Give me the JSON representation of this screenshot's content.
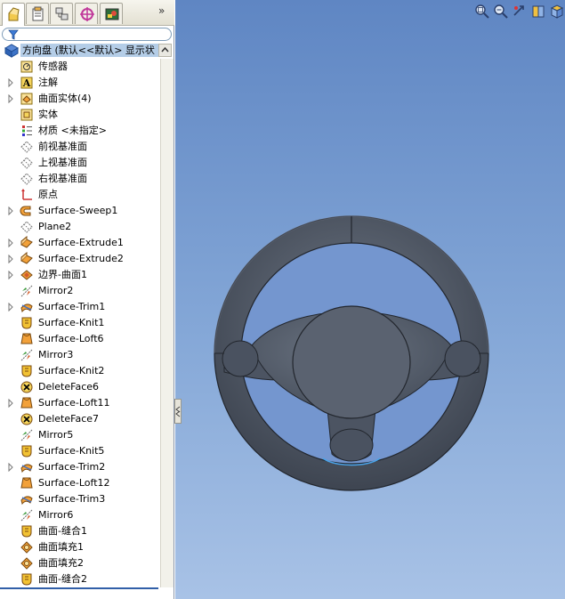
{
  "panel": {
    "tabs": [
      {
        "name": "featuremanager-tab",
        "icon": "feature-tree-icon"
      },
      {
        "name": "propertymanager-tab",
        "icon": "property-manager-icon"
      },
      {
        "name": "configurationmanager-tab",
        "icon": "configuration-manager-icon"
      },
      {
        "name": "dimxpert-tab",
        "icon": "dimxpert-icon"
      },
      {
        "name": "display-manager-tab",
        "icon": "display-manager-icon"
      }
    ],
    "more_tabs_glyph": "»"
  },
  "tree": {
    "root_label": "方向盘 (默认<<默认> 显示状",
    "items": [
      {
        "label": "传感器",
        "icon": "sensor-icon",
        "expandable": false
      },
      {
        "label": "注解",
        "icon": "annotation-icon",
        "expandable": true
      },
      {
        "label": "曲面实体(4)",
        "icon": "surface-bodies-icon",
        "expandable": true
      },
      {
        "label": "实体",
        "icon": "solid-bodies-icon",
        "expandable": false
      },
      {
        "label": "材质 <未指定>",
        "icon": "material-icon",
        "expandable": false
      },
      {
        "label": "前视基准面",
        "icon": "plane-icon",
        "expandable": false
      },
      {
        "label": "上视基准面",
        "icon": "plane-icon",
        "expandable": false
      },
      {
        "label": "右视基准面",
        "icon": "plane-icon",
        "expandable": false
      },
      {
        "label": "原点",
        "icon": "origin-icon",
        "expandable": false
      },
      {
        "label": "Surface-Sweep1",
        "icon": "surface-sweep-icon",
        "expandable": true
      },
      {
        "label": "Plane2",
        "icon": "plane-icon",
        "expandable": false
      },
      {
        "label": "Surface-Extrude1",
        "icon": "surface-extrude-icon",
        "expandable": true
      },
      {
        "label": "Surface-Extrude2",
        "icon": "surface-extrude-icon",
        "expandable": true
      },
      {
        "label": "边界-曲面1",
        "icon": "boundary-surface-icon",
        "expandable": true
      },
      {
        "label": "Mirror2",
        "icon": "mirror-icon",
        "expandable": false
      },
      {
        "label": "Surface-Trim1",
        "icon": "surface-trim-icon",
        "expandable": true
      },
      {
        "label": "Surface-Knit1",
        "icon": "surface-knit-icon",
        "expandable": false
      },
      {
        "label": "Surface-Loft6",
        "icon": "surface-loft-icon",
        "expandable": false
      },
      {
        "label": "Mirror3",
        "icon": "mirror-icon",
        "expandable": false
      },
      {
        "label": "Surface-Knit2",
        "icon": "surface-knit-icon",
        "expandable": false
      },
      {
        "label": "DeleteFace6",
        "icon": "delete-face-icon",
        "expandable": false
      },
      {
        "label": "Surface-Loft11",
        "icon": "surface-loft-icon",
        "expandable": true
      },
      {
        "label": "DeleteFace7",
        "icon": "delete-face-icon",
        "expandable": false
      },
      {
        "label": "Mirror5",
        "icon": "mirror-icon",
        "expandable": false
      },
      {
        "label": "Surface-Knit5",
        "icon": "surface-knit-icon",
        "expandable": false
      },
      {
        "label": "Surface-Trim2",
        "icon": "surface-trim-icon",
        "expandable": true
      },
      {
        "label": "Surface-Loft12",
        "icon": "surface-loft-icon",
        "expandable": false
      },
      {
        "label": "Surface-Trim3",
        "icon": "surface-trim-icon",
        "expandable": false
      },
      {
        "label": "Mirror6",
        "icon": "mirror-icon",
        "expandable": false
      },
      {
        "label": "曲面-缝合1",
        "icon": "surface-knit-icon",
        "expandable": false
      },
      {
        "label": "曲面填充1",
        "icon": "surface-fill-icon",
        "expandable": false
      },
      {
        "label": "曲面填充2",
        "icon": "surface-fill-icon",
        "expandable": false
      },
      {
        "label": "曲面-缝合2",
        "icon": "surface-knit-icon",
        "expandable": false
      }
    ]
  },
  "viewport": {
    "toolbar": [
      {
        "name": "zoom-to-fit-button",
        "icon": "zoom-to-fit-icon"
      },
      {
        "name": "zoom-to-area-button",
        "icon": "zoom-to-area-icon"
      },
      {
        "name": "previous-view-button",
        "icon": "previous-view-icon"
      },
      {
        "name": "section-view-button",
        "icon": "section-view-icon"
      },
      {
        "name": "view-orientation-button",
        "icon": "view-orientation-icon"
      }
    ],
    "colors": {
      "background_top": "#5f86c3",
      "background_bottom": "#a8c2e6",
      "model": "#4f5866",
      "selection_edge": "#4aa3e8"
    }
  }
}
